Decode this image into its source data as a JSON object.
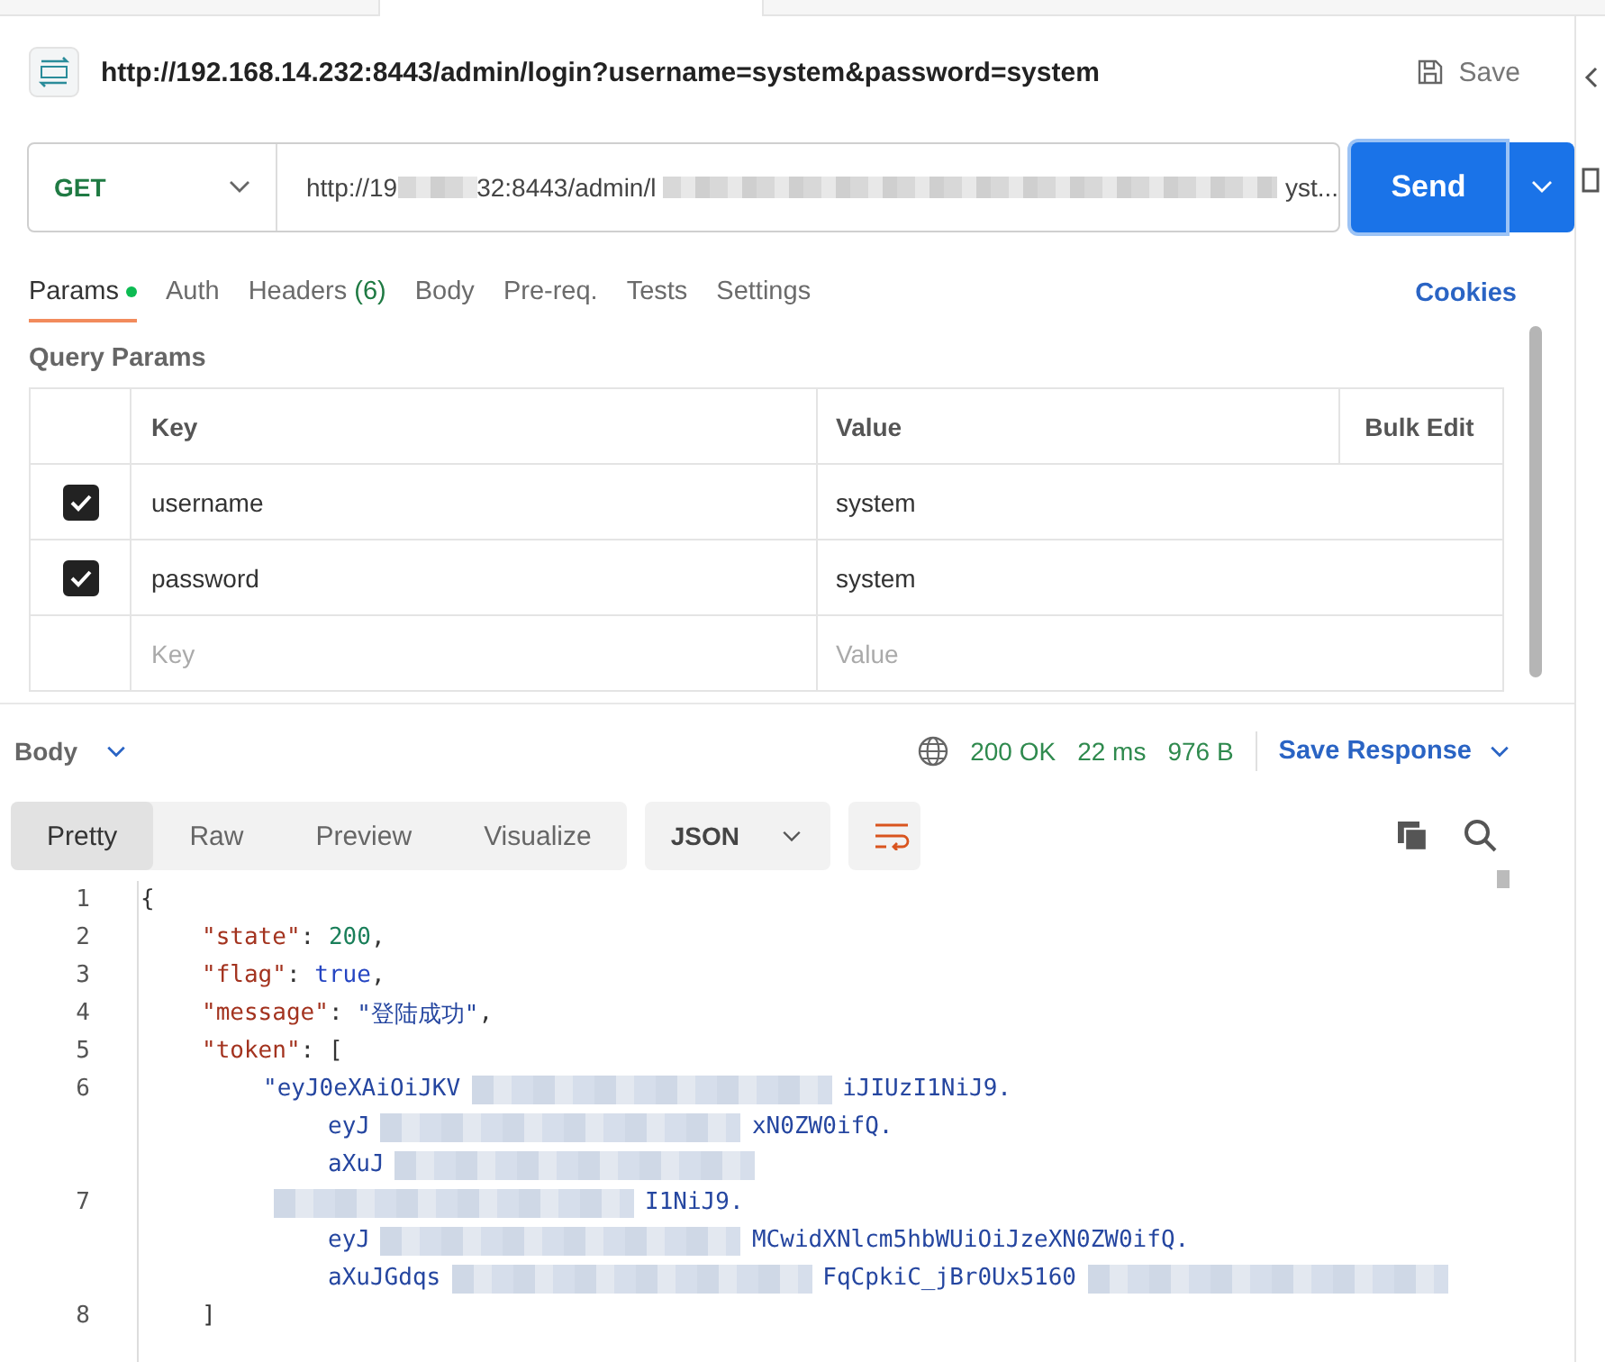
{
  "request": {
    "title": "http://192.168.14.232:8443/admin/login?username=system&password=system",
    "save_label": "Save",
    "method": "GET",
    "url_start": "http://19",
    "url_mid": "32:8443/admin/l",
    "url_end": "yst...",
    "send_label": "Send"
  },
  "request_tabs": [
    {
      "label": "Params",
      "selected": true,
      "dot": true
    },
    {
      "label": "Auth",
      "selected": false
    },
    {
      "label": "Headers",
      "count": "(6)",
      "selected": false
    },
    {
      "label": "Body",
      "selected": false
    },
    {
      "label": "Pre-req.",
      "selected": false
    },
    {
      "label": "Tests",
      "selected": false
    },
    {
      "label": "Settings",
      "selected": false
    }
  ],
  "cookies_label": "Cookies",
  "query_params": {
    "title": "Query Params",
    "columns": [
      "Key",
      "Value"
    ],
    "bulk_edit": "Bulk Edit",
    "rows": [
      {
        "key": "username",
        "value": "system",
        "checked": true
      },
      {
        "key": "password",
        "value": "system",
        "checked": true
      }
    ],
    "placeholder_key": "Key",
    "placeholder_value": "Value"
  },
  "response": {
    "section": "Body",
    "status": "200 OK",
    "time": "22 ms",
    "size": "976 B",
    "save_response": "Save Response"
  },
  "view_tabs": [
    {
      "label": "Pretty",
      "selected": true
    },
    {
      "label": "Raw",
      "selected": false
    },
    {
      "label": "Preview",
      "selected": false
    },
    {
      "label": "Visualize",
      "selected": false
    }
  ],
  "format": "JSON",
  "code_lines": [
    {
      "num": "1",
      "kind": "brace",
      "rows": [
        {
          "parts": [
            {
              "kind": "punct",
              "text": "{"
            }
          ]
        }
      ]
    },
    {
      "num": "2",
      "kind": "member",
      "rows": [
        {
          "parts": [
            {
              "kind": "key",
              "text": "\"state\""
            },
            {
              "kind": "punct",
              "text": ": "
            },
            {
              "kind": "number",
              "text": "200"
            },
            {
              "kind": "punct",
              "text": ","
            }
          ]
        }
      ]
    },
    {
      "num": "3",
      "kind": "member",
      "rows": [
        {
          "parts": [
            {
              "kind": "key",
              "text": "\"flag\""
            },
            {
              "kind": "punct",
              "text": ": "
            },
            {
              "kind": "bool",
              "text": "true"
            },
            {
              "kind": "punct",
              "text": ","
            }
          ]
        }
      ]
    },
    {
      "num": "4",
      "kind": "member",
      "rows": [
        {
          "parts": [
            {
              "kind": "key",
              "text": "\"message\""
            },
            {
              "kind": "punct",
              "text": ": "
            },
            {
              "kind": "string",
              "text": "\"登陆成功\""
            },
            {
              "kind": "punct",
              "text": ","
            }
          ]
        }
      ]
    },
    {
      "num": "5",
      "kind": "member",
      "rows": [
        {
          "parts": [
            {
              "kind": "key",
              "text": "\"token\""
            },
            {
              "kind": "punct",
              "text": ": ["
            }
          ]
        }
      ]
    },
    {
      "num": "6",
      "kind": "item",
      "rows": [
        {
          "parts": [
            {
              "kind": "string",
              "text": "\"eyJ0eXAiOiJKV"
            },
            {
              "kind": "blur"
            },
            {
              "kind": "string",
              "text": "iJIUzI1NiJ9."
            }
          ]
        },
        {
          "parts": [
            {
              "kind": "string",
              "text": "eyJ"
            },
            {
              "kind": "blur"
            },
            {
              "kind": "string",
              "text": "xN0ZW0ifQ."
            }
          ]
        },
        {
          "parts": [
            {
              "kind": "string",
              "text": "aXuJ"
            },
            {
              "kind": "blur"
            }
          ]
        }
      ]
    },
    {
      "num": "7",
      "kind": "item",
      "rows": [
        {
          "parts": [
            {
              "kind": "blur"
            },
            {
              "kind": "string",
              "text": "I1NiJ9."
            }
          ]
        },
        {
          "parts": [
            {
              "kind": "string",
              "text": "eyJ"
            },
            {
              "kind": "blur"
            },
            {
              "kind": "string",
              "text": "MCwidXNlcm5hbWUiOiJzeXN0ZW0ifQ."
            }
          ]
        },
        {
          "parts": [
            {
              "kind": "string",
              "text": "aXuJGdqs"
            },
            {
              "kind": "blur"
            },
            {
              "kind": "string",
              "text": "FqCpkiC_jBr0Ux5160"
            },
            {
              "kind": "blur"
            }
          ]
        }
      ]
    },
    {
      "num": "8",
      "kind": "member",
      "rows": [
        {
          "parts": [
            {
              "kind": "punct",
              "text": "]"
            }
          ]
        }
      ]
    }
  ]
}
